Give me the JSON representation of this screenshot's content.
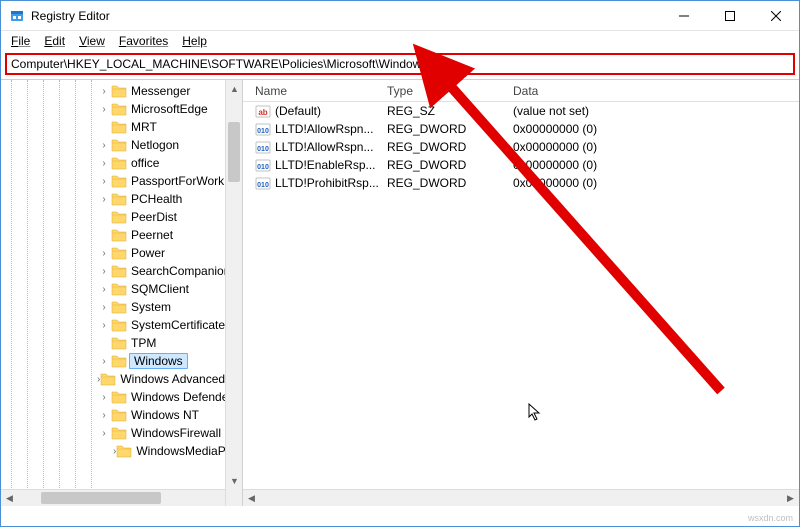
{
  "window": {
    "title": "Registry Editor"
  },
  "menu": {
    "file": "File",
    "edit": "Edit",
    "view": "View",
    "favorites": "Favorites",
    "help": "Help"
  },
  "address": {
    "path": "Computer\\HKEY_LOCAL_MACHINE\\SOFTWARE\\Policies\\Microsoft\\Windows"
  },
  "tree": {
    "items": [
      {
        "label": "Messenger",
        "expandable": true
      },
      {
        "label": "MicrosoftEdge",
        "expandable": true
      },
      {
        "label": "MRT",
        "expandable": false
      },
      {
        "label": "Netlogon",
        "expandable": true
      },
      {
        "label": "office",
        "expandable": true
      },
      {
        "label": "PassportForWork",
        "expandable": true
      },
      {
        "label": "PCHealth",
        "expandable": true
      },
      {
        "label": "PeerDist",
        "expandable": false
      },
      {
        "label": "Peernet",
        "expandable": false
      },
      {
        "label": "Power",
        "expandable": true
      },
      {
        "label": "SearchCompanion",
        "expandable": true
      },
      {
        "label": "SQMClient",
        "expandable": true
      },
      {
        "label": "System",
        "expandable": true
      },
      {
        "label": "SystemCertificates",
        "expandable": true
      },
      {
        "label": "TPM",
        "expandable": false
      },
      {
        "label": "Windows",
        "expandable": true,
        "selected": true
      },
      {
        "label": "Windows Advanced Threat Protection",
        "expandable": true
      },
      {
        "label": "Windows Defender",
        "expandable": true
      },
      {
        "label": "Windows NT",
        "expandable": true
      },
      {
        "label": "WindowsFirewall",
        "expandable": true
      },
      {
        "label": "WindowsMediaPlayer",
        "expandable": true,
        "sub": true
      }
    ]
  },
  "list": {
    "columns": {
      "name": "Name",
      "type": "Type",
      "data": "Data"
    },
    "rows": [
      {
        "icon": "sz",
        "name": "(Default)",
        "type": "REG_SZ",
        "data": "(value not set)"
      },
      {
        "icon": "dw",
        "name": "LLTD!AllowRspn...",
        "type": "REG_DWORD",
        "data": "0x00000000 (0)"
      },
      {
        "icon": "dw",
        "name": "LLTD!AllowRspn...",
        "type": "REG_DWORD",
        "data": "0x00000000 (0)"
      },
      {
        "icon": "dw",
        "name": "LLTD!EnableRsp...",
        "type": "REG_DWORD",
        "data": "0x00000000 (0)"
      },
      {
        "icon": "dw",
        "name": "LLTD!ProhibitRsp...",
        "type": "REG_DWORD",
        "data": "0x00000000 (0)"
      }
    ]
  },
  "watermark": "wsxdn.com"
}
